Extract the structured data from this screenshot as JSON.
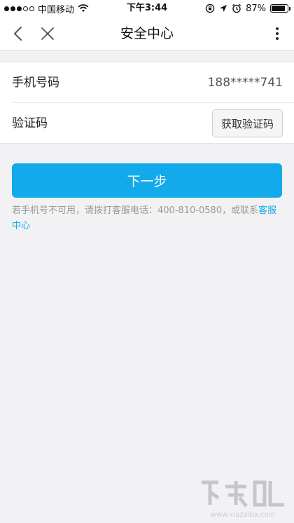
{
  "status_bar": {
    "carrier": "中国移动",
    "time": "下午3:44",
    "battery_percent": "87%",
    "battery_level": 0.87,
    "icons": [
      "signal-icon",
      "wifi-icon",
      "orientation-lock-icon",
      "location-icon",
      "alarm-icon",
      "battery-icon"
    ]
  },
  "nav": {
    "title": "安全中心",
    "back_icon": "chevron-left-icon",
    "close_icon": "close-icon",
    "more_icon": "more-vertical-icon"
  },
  "form": {
    "phone_label": "手机号码",
    "phone_value": "188*****741",
    "code_label": "验证码",
    "code_value": "",
    "code_placeholder": "",
    "get_code_label": "获取验证码"
  },
  "next_button_label": "下一步",
  "hint": {
    "text": "若手机号不可用，请拨打客服电话：400-810-0580，或联系",
    "link": "客服中心"
  },
  "watermark": {
    "url": "www.xiazaiba.com"
  },
  "colors": {
    "accent": "#12aaeb",
    "background": "#f2f2f4",
    "surface": "#ffffff"
  }
}
